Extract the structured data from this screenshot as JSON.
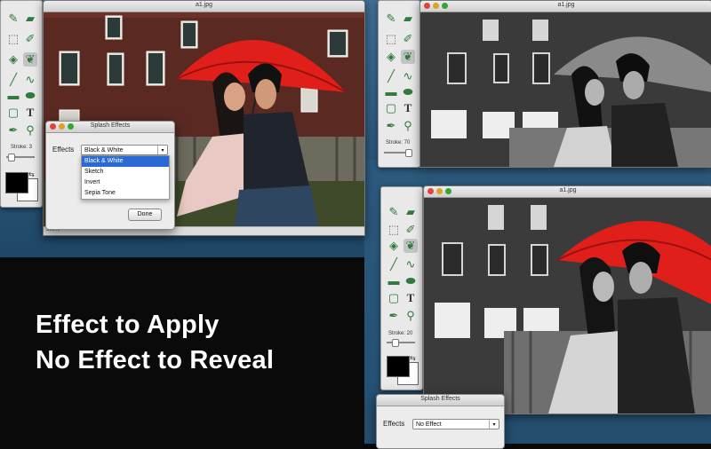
{
  "window_title": "a1.jpg",
  "dialog_title": "Splash Effects",
  "effects_label": "Effects",
  "menu": {
    "selected": "Black & White",
    "options": [
      "Black & White",
      "Sketch",
      "Invert",
      "Sepia Tone"
    ]
  },
  "bottom_effects_value": "No Effect",
  "done_label": "Done",
  "zoom": "100%",
  "stroke_left": "Stroke: 3",
  "stroke_right_top": "Stroke: 70",
  "stroke_right_bottom": "Stroke: 20",
  "caption": {
    "line1": "Effect to Apply",
    "line2": "No Effect to Reveal"
  },
  "colors": {
    "umbrella_red": "#e01f1a",
    "tool_green": "#2f7a3c",
    "dropdown_highlight": "#2a6ad4"
  },
  "tool_icons": [
    "brush-icon",
    "eraser-icon",
    "marquee-icon",
    "lasso-icon",
    "fill-icon",
    "drop-icon",
    "line-icon",
    "curve-icon",
    "rectangle-icon",
    "ellipse-icon",
    "rounded-rect-icon",
    "text-icon",
    "eyedropper-icon",
    "zoom-icon"
  ]
}
